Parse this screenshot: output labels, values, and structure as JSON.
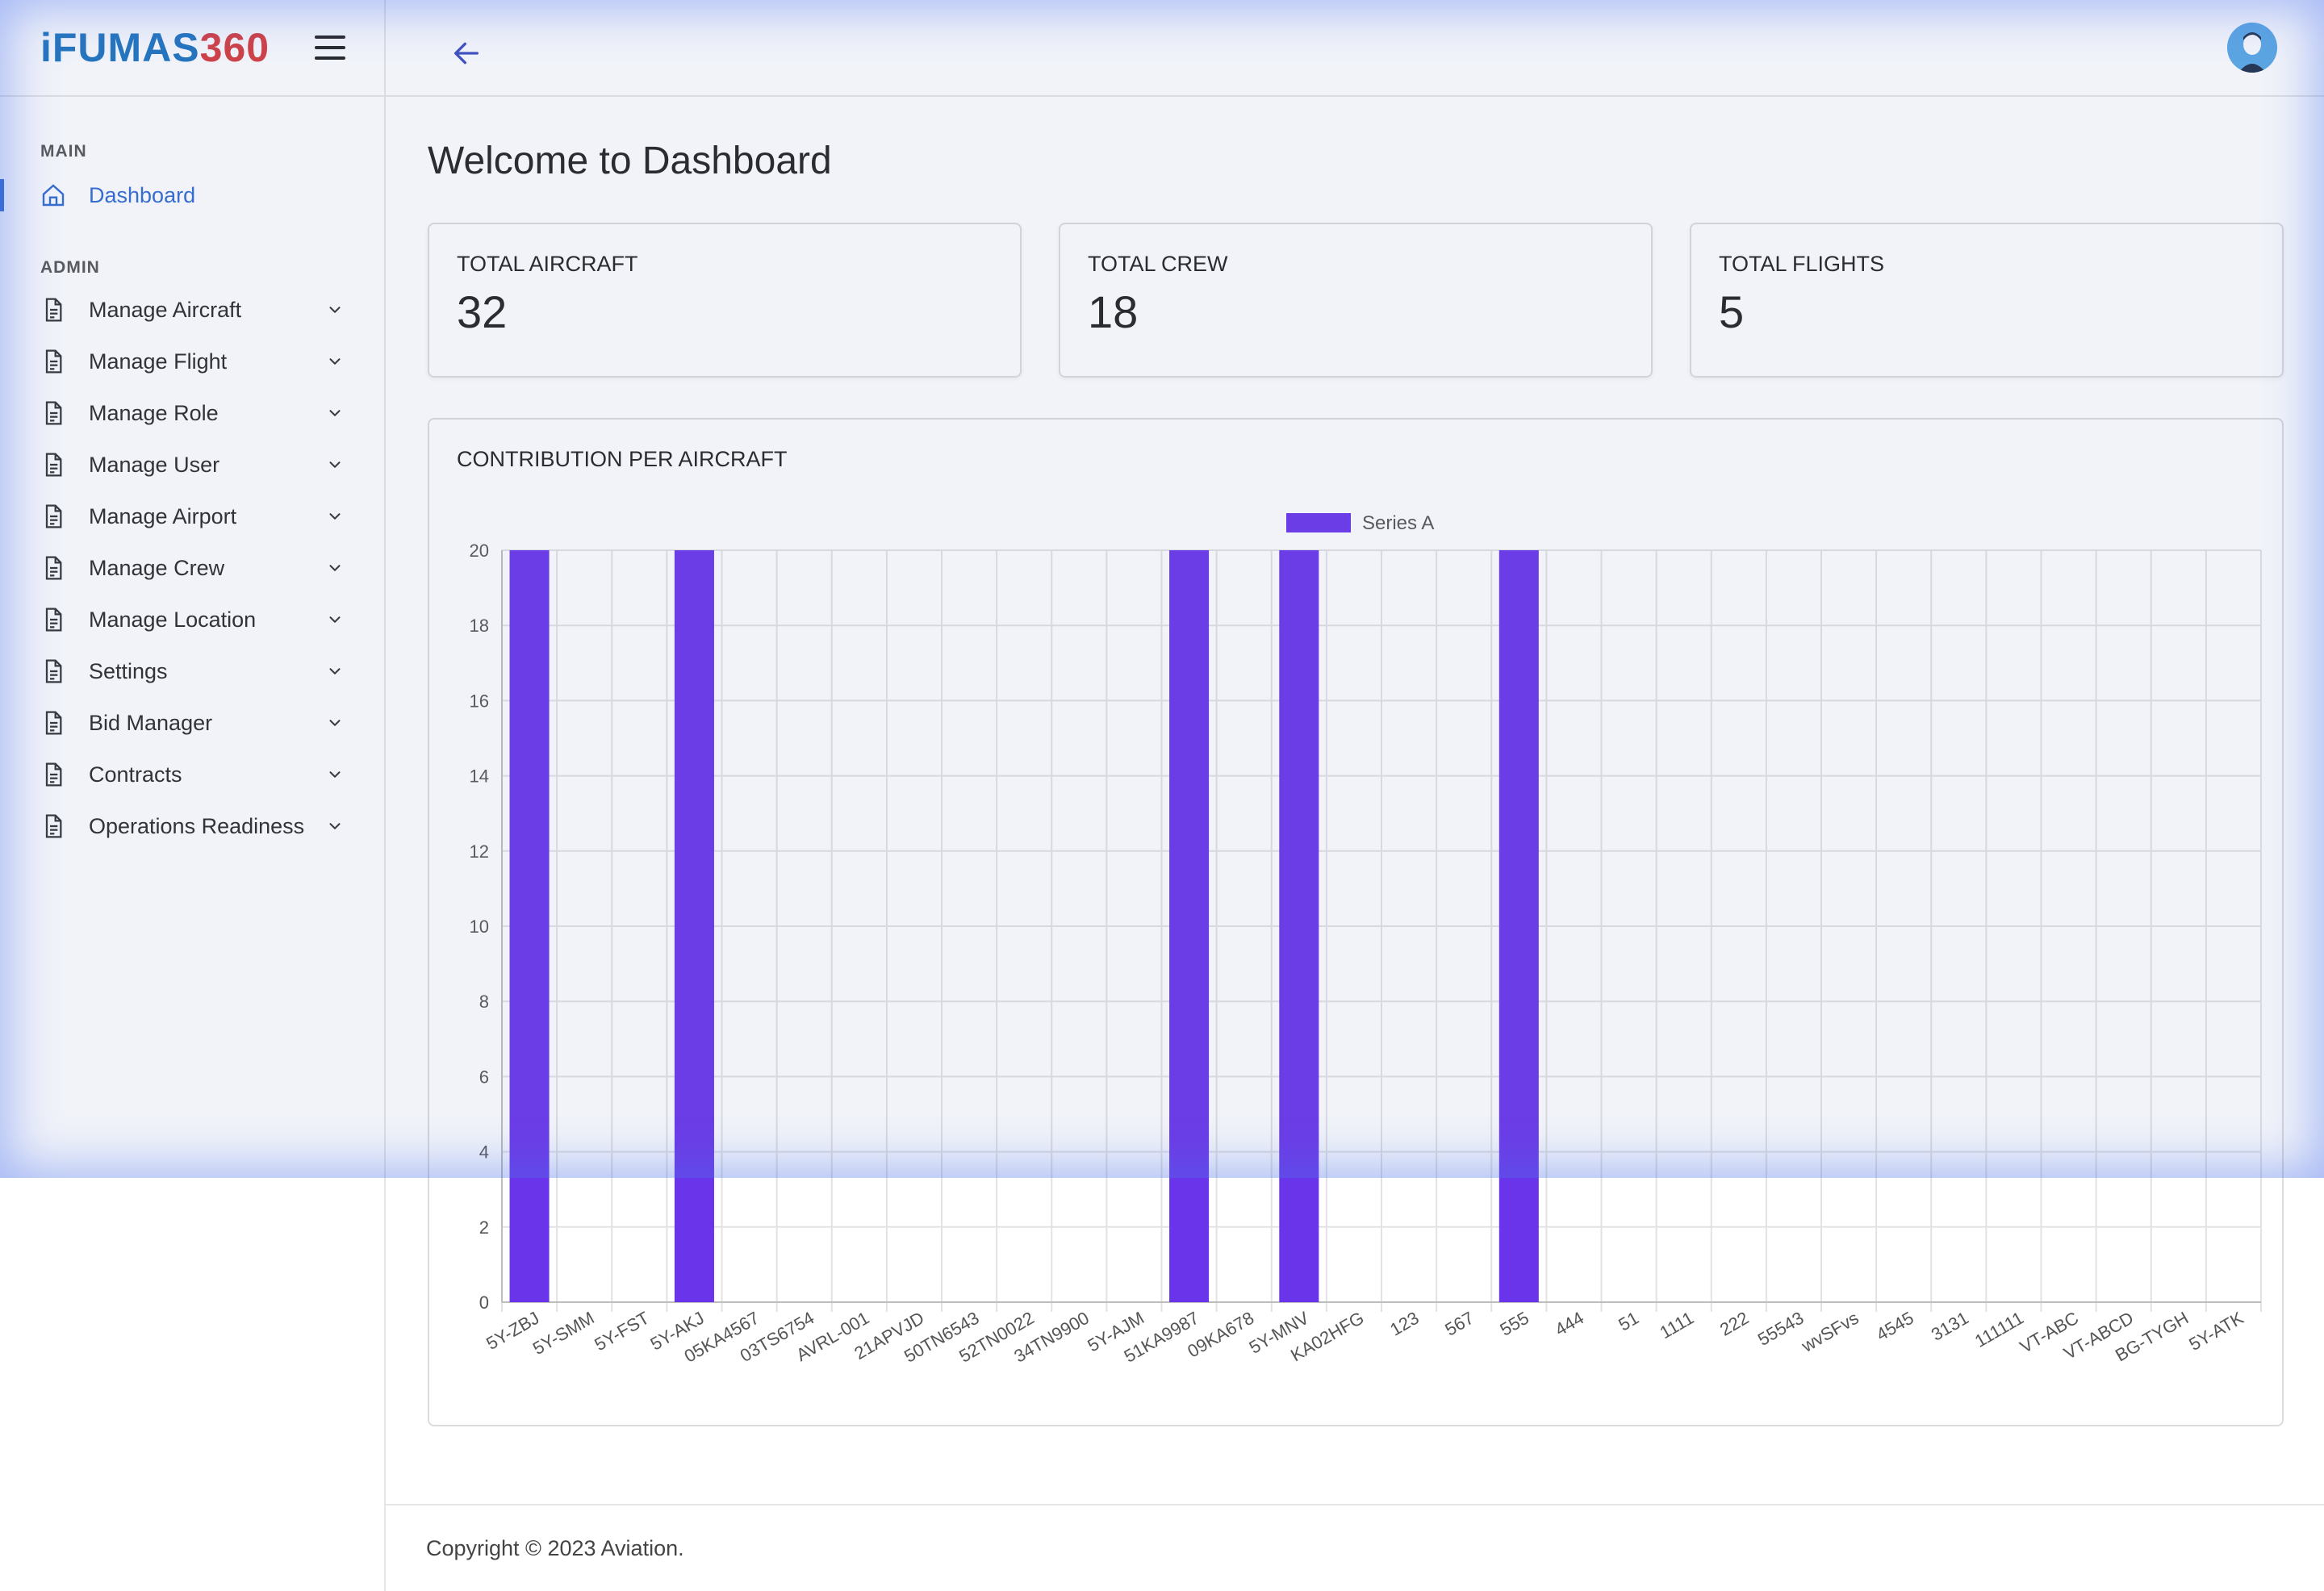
{
  "brand": {
    "logo_part1": "iFUMAS",
    "logo_part2": "360"
  },
  "sidebar": {
    "main_label": "MAIN",
    "admin_label": "ADMIN",
    "main_items": [
      {
        "label": "Dashboard",
        "icon": "home-icon",
        "active": true
      }
    ],
    "admin_items": [
      {
        "label": "Manage Aircraft",
        "icon": "document-icon"
      },
      {
        "label": "Manage Flight",
        "icon": "document-icon"
      },
      {
        "label": "Manage Role",
        "icon": "document-icon"
      },
      {
        "label": "Manage User",
        "icon": "document-icon"
      },
      {
        "label": "Manage Airport",
        "icon": "document-icon"
      },
      {
        "label": "Manage Crew",
        "icon": "document-icon"
      },
      {
        "label": "Manage Location",
        "icon": "document-icon"
      },
      {
        "label": "Settings",
        "icon": "document-icon"
      },
      {
        "label": "Bid Manager",
        "icon": "document-icon"
      },
      {
        "label": "Contracts",
        "icon": "document-icon"
      },
      {
        "label": "Operations Readiness",
        "icon": "document-icon"
      }
    ]
  },
  "header": {
    "title": "Welcome to Dashboard"
  },
  "stats": [
    {
      "title": "TOTAL AIRCRAFT",
      "value": "32"
    },
    {
      "title": "TOTAL CREW",
      "value": "18"
    },
    {
      "title": "TOTAL FLIGHTS",
      "value": "5"
    }
  ],
  "chart_title": "CONTRIBUTION PER AIRCRAFT",
  "chart_data": {
    "type": "bar",
    "title": "",
    "xlabel": "",
    "ylabel": "",
    "ylim": [
      0,
      20
    ],
    "yticks": [
      0,
      2,
      4,
      6,
      8,
      10,
      12,
      14,
      16,
      18,
      20
    ],
    "grid": true,
    "legend": "top-center",
    "bar_color": "#6a35ea",
    "categories": [
      "5Y-ZBJ",
      "5Y-SMM",
      "5Y-FST",
      "5Y-AKJ",
      "05KA4567",
      "03TS6754",
      "AVRL-001",
      "21APVJD",
      "50TN6543",
      "52TN0022",
      "34TN9900",
      "5Y-AJM",
      "51KA9987",
      "09KA678",
      "5Y-MNV",
      "KA02HFG",
      "123",
      "567",
      "555",
      "444",
      "51",
      "1111",
      "222",
      "55543",
      "wvSFvs",
      "4545",
      "3131",
      "111111",
      "VT-ABC",
      "VT-ABCD",
      "BG-TYGH",
      "5Y-ATK"
    ],
    "series": [
      {
        "name": "Series A",
        "values": [
          20,
          0,
          0,
          20,
          0,
          0,
          0,
          0,
          0,
          0,
          0,
          0,
          20,
          0,
          20,
          0,
          0,
          0,
          20,
          0,
          0,
          0,
          0,
          0,
          0,
          0,
          0,
          0,
          0,
          0,
          0,
          0
        ]
      }
    ]
  },
  "footer": {
    "text": "Copyright © 2023 Aviation."
  },
  "colors": {
    "accent": "#2f6ad0",
    "bar": "#6a35ea",
    "logo_blue": "#1e73be",
    "logo_red": "#d93a3a"
  }
}
